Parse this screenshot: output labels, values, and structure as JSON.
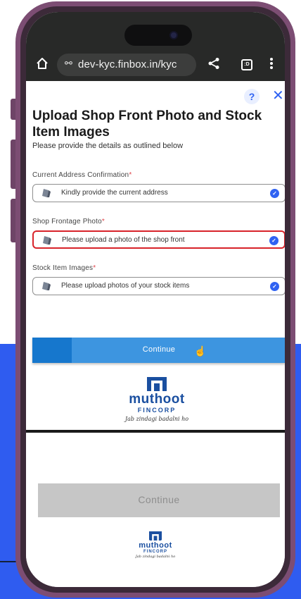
{
  "browser": {
    "url": "dev-kyc.finbox.in/kyc",
    "tab_box_label": ":D"
  },
  "form": {
    "help_label": "?",
    "close_label": "✕",
    "title": "Upload Shop Front Photo and Stock Item Images",
    "subtitle": "Please provide the details as outlined below",
    "required_mark": "*",
    "fields": [
      {
        "label": "Current Address Confirmation",
        "placeholder": "Kindly provide the current address"
      },
      {
        "label": "Shop Frontage Photo",
        "placeholder": "Please upload a photo of the shop front"
      },
      {
        "label": "Stock Item Images",
        "placeholder": "Please upload photos of your stock items"
      }
    ],
    "continue_label": "Continue"
  },
  "brand": {
    "name": "muthoot",
    "sub": "FINCORP",
    "tagline": "Jab zindagi badalni ho"
  },
  "lower": {
    "continue_label": "Continue"
  },
  "colors": {
    "accent": "#2f62f2",
    "button": "#3d95e0",
    "selected_border": "#d8232a",
    "background_blue": "#2f5cf0",
    "phone_frame": "#7c4d73"
  }
}
